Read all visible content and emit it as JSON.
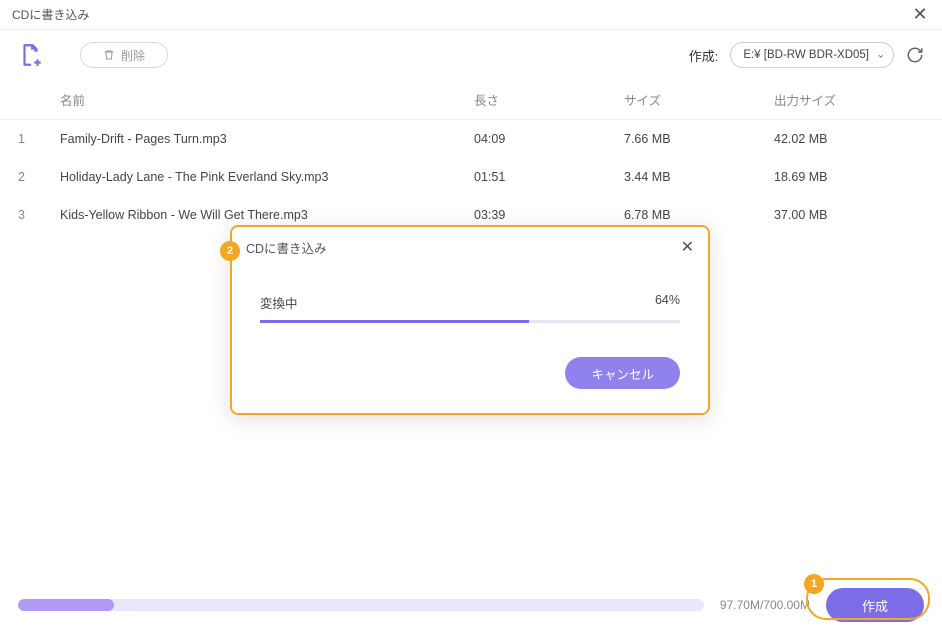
{
  "window": {
    "title": "CDに書き込み"
  },
  "toolbar": {
    "delete_label": "削除",
    "drive_label": "作成:",
    "drive_value": "E:¥ [BD-RW  BDR-XD05]"
  },
  "columns": {
    "name": "名前",
    "length": "長さ",
    "size": "サイズ",
    "output": "出力サイズ"
  },
  "rows": [
    {
      "idx": "1",
      "name": "Family-Drift - Pages Turn.mp3",
      "length": "04:09",
      "size": "7.66 MB",
      "output": "42.02 MB"
    },
    {
      "idx": "2",
      "name": "Holiday-Lady Lane - The Pink Everland Sky.mp3",
      "length": "01:51",
      "size": "3.44 MB",
      "output": "18.69 MB"
    },
    {
      "idx": "3",
      "name": "Kids-Yellow Ribbon - We Will Get There.mp3",
      "length": "03:39",
      "size": "6.78 MB",
      "output": "37.00 MB"
    }
  ],
  "footer": {
    "capacity_text": "97.70M/700.00M",
    "capacity_pct": 14,
    "create_label": "作成"
  },
  "modal": {
    "title": "CDに書き込み",
    "status": "変換中",
    "percent_text": "64%",
    "percent": 64,
    "cancel_label": "キャンセル"
  },
  "callouts": {
    "one": "1",
    "two": "2"
  }
}
